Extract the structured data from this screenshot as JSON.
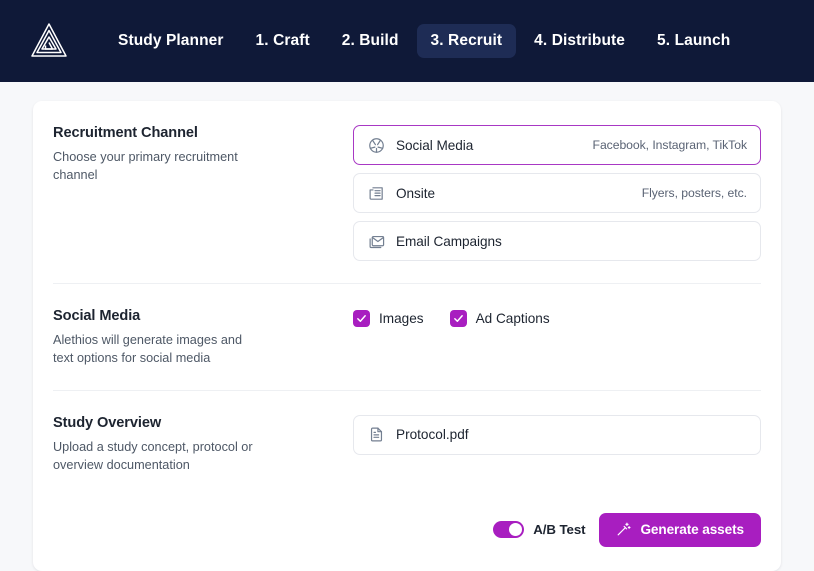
{
  "header": {
    "logo_name": "alethios-logo",
    "background_color": "#0f1938",
    "nav_items": [
      {
        "label": "Study Planner",
        "active": false
      },
      {
        "label": "1. Craft",
        "active": false
      },
      {
        "label": "2. Build",
        "active": false
      },
      {
        "label": "3. Recruit",
        "active": true
      },
      {
        "label": "4. Distribute",
        "active": false
      },
      {
        "label": "5. Launch",
        "active": false
      }
    ],
    "active_tab_color": "#1e2c55"
  },
  "accent_color": "#a81ec0",
  "selected_border_color": "#a838c4",
  "sections": {
    "recruitment_channel": {
      "title": "Recruitment Channel",
      "description": "Choose your primary recruitment channel",
      "options": [
        {
          "icon": "aperture-icon",
          "label": "Social Media",
          "hint": "Facebook, Instagram, TikTok",
          "selected": true
        },
        {
          "icon": "newspaper-icon",
          "label": "Onsite",
          "hint": "Flyers, posters, etc.",
          "selected": false
        },
        {
          "icon": "mail-icon",
          "label": "Email Campaigns",
          "hint": "",
          "selected": false
        }
      ]
    },
    "social_media": {
      "title": "Social Media",
      "description": "Alethios will generate images and text options for social media",
      "checkboxes": [
        {
          "label": "Images",
          "checked": true
        },
        {
          "label": "Ad Captions",
          "checked": true
        }
      ]
    },
    "study_overview": {
      "title": "Study Overview",
      "description": "Upload a study concept, protocol or overview documentation",
      "file": {
        "icon": "file-text-icon",
        "name": "Protocol.pdf"
      }
    }
  },
  "footer": {
    "toggle": {
      "label": "A/B Test",
      "on": true
    },
    "generate_button": {
      "label": "Generate assets",
      "icon": "magic-wand-icon"
    }
  }
}
